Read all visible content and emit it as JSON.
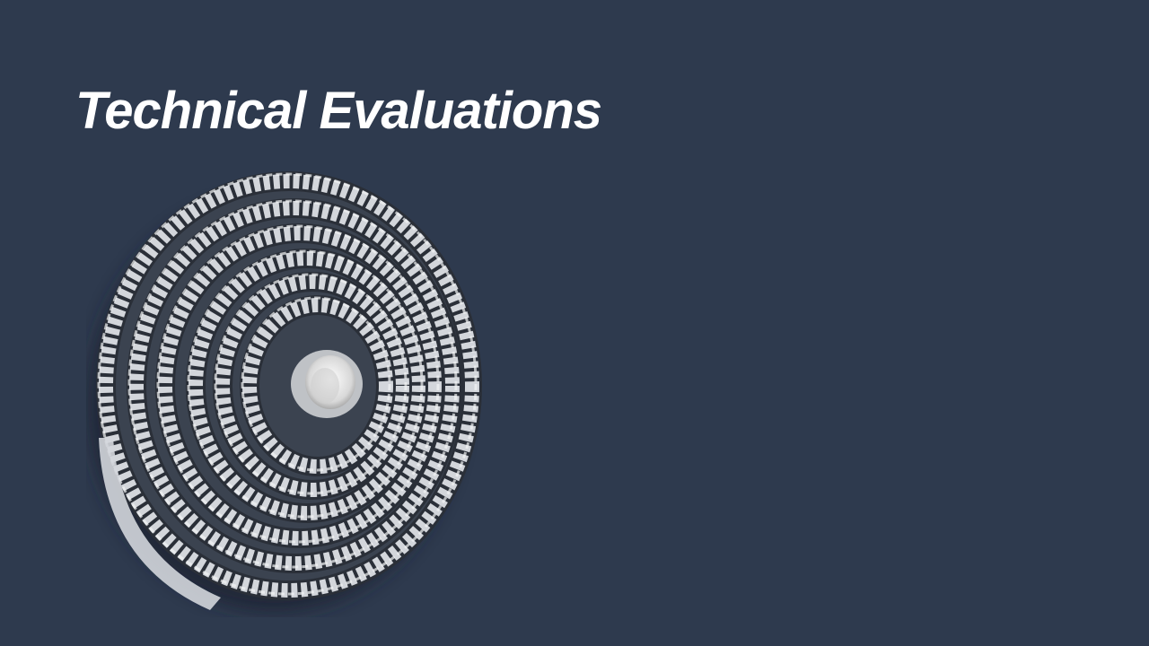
{
  "slide": {
    "title": "Technical Evaluations",
    "background_color": "#2e3a4e",
    "title_color": "#ffffff"
  },
  "photo": {
    "subject": "coiled-belt-image",
    "belt_color": "#d3d6db",
    "shadow_color": "#1c2533",
    "core_color": "#eeeeee"
  }
}
